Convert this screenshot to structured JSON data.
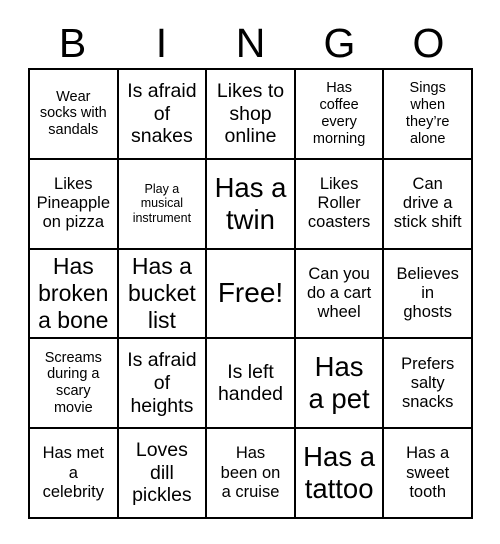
{
  "card": {
    "title": "BINGO",
    "header_letters": [
      "B",
      "I",
      "N",
      "G",
      "O"
    ],
    "grid_size": "5x5",
    "free_space_index": 12,
    "colors": {
      "border": "#000000",
      "cell_background": "#ffffff",
      "text": "#000000",
      "page_background": "#ffffff"
    },
    "cells": [
      {
        "text": "Wear\nsocks with\nsandals",
        "size": "s",
        "column": "B",
        "row": 1
      },
      {
        "text": "Is afraid\nof\nsnakes",
        "size": "l",
        "column": "I",
        "row": 1
      },
      {
        "text": "Likes to\nshop\nonline",
        "size": "l",
        "column": "N",
        "row": 1
      },
      {
        "text": "Has\ncoffee\nevery\nmorning",
        "size": "s",
        "column": "G",
        "row": 1
      },
      {
        "text": "Sings\nwhen\nthey’re\nalone",
        "size": "s",
        "column": "O",
        "row": 1
      },
      {
        "text": "Likes\nPineapple\non pizza",
        "size": "m",
        "column": "B",
        "row": 2
      },
      {
        "text": "Play a\nmusical\ninstrument",
        "size": "xs",
        "column": "I",
        "row": 2
      },
      {
        "text": "Has a\ntwin",
        "size": "xxl",
        "column": "N",
        "row": 2
      },
      {
        "text": "Likes\nRoller\ncoasters",
        "size": "m",
        "column": "G",
        "row": 2
      },
      {
        "text": "Can\ndrive a\nstick shift",
        "size": "m",
        "column": "O",
        "row": 2
      },
      {
        "text": "Has\nbroken\na bone",
        "size": "xl",
        "column": "B",
        "row": 3
      },
      {
        "text": "Has a\nbucket\nlist",
        "size": "xl",
        "column": "I",
        "row": 3
      },
      {
        "text": "Free!",
        "size": "free",
        "column": "N",
        "row": 3
      },
      {
        "text": "Can you\ndo a cart\nwheel",
        "size": "m",
        "column": "G",
        "row": 3
      },
      {
        "text": "Believes\nin\nghosts",
        "size": "m",
        "column": "O",
        "row": 3
      },
      {
        "text": "Screams\nduring a\nscary\nmovie",
        "size": "s",
        "column": "B",
        "row": 4
      },
      {
        "text": "Is afraid\nof\nheights",
        "size": "l",
        "column": "I",
        "row": 4
      },
      {
        "text": "Is left\nhanded",
        "size": "l",
        "column": "N",
        "row": 4
      },
      {
        "text": "Has\na pet",
        "size": "xxl",
        "column": "G",
        "row": 4
      },
      {
        "text": "Prefers\nsalty\nsnacks",
        "size": "m",
        "column": "O",
        "row": 4
      },
      {
        "text": "Has met\na\ncelebrity",
        "size": "m",
        "column": "B",
        "row": 5
      },
      {
        "text": "Loves\ndill\npickles",
        "size": "l",
        "column": "I",
        "row": 5
      },
      {
        "text": "Has\nbeen on\na cruise",
        "size": "m",
        "column": "N",
        "row": 5
      },
      {
        "text": "Has a\ntattoo",
        "size": "xxl",
        "column": "G",
        "row": 5
      },
      {
        "text": "Has a\nsweet\ntooth",
        "size": "m",
        "column": "O",
        "row": 5
      }
    ]
  }
}
